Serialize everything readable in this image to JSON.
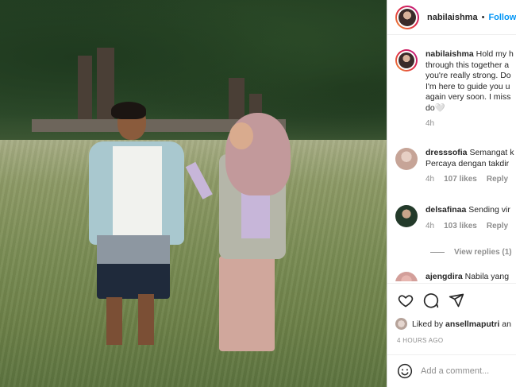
{
  "header": {
    "username": "nabilaishma",
    "separator": "•",
    "follow_label": "Follow"
  },
  "caption": {
    "username": "nabilaishma",
    "text": "Hold my h\nthrough this together a\nyou're really strong. Do\nI'm here to guide you u\nagain very soon. I miss\ndo🤍",
    "time": "4h"
  },
  "comments": [
    {
      "username": "dresssofia",
      "text": "Semangat k\nPercaya dengan takdir",
      "time": "4h",
      "likes": "107 likes",
      "reply_label": "Reply"
    },
    {
      "username": "delsafinaa",
      "text": "Sending vir",
      "time": "4h",
      "likes": "103 likes",
      "reply_label": "Reply"
    },
    {
      "username": "ajengdira",
      "text": "Nabila yang",
      "time": "",
      "likes": "",
      "reply_label": ""
    }
  ],
  "view_replies": "View replies (1)",
  "liked_by": {
    "prefix": "Liked by",
    "username": "ansellmaputri",
    "suffix": "an"
  },
  "post_time": "4 HOURS AGO",
  "add_comment_placeholder": "Add a comment...",
  "icons": [
    "heart-icon",
    "comment-icon",
    "share-icon",
    "emoji-icon"
  ],
  "colors": {
    "follow": "#0095f6",
    "muted": "#8e8e8e",
    "text": "#262626"
  }
}
